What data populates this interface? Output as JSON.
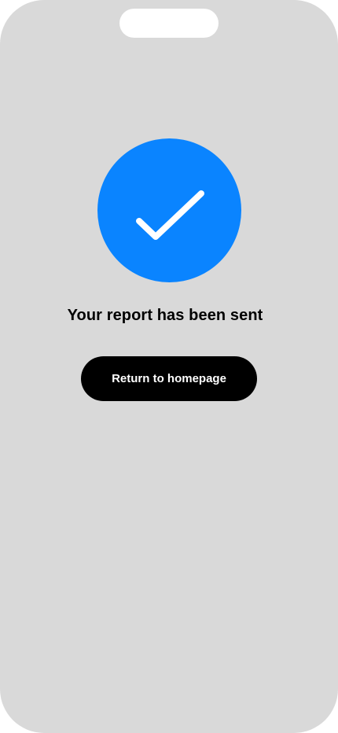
{
  "confirmation": {
    "icon": "checkmark-icon",
    "icon_bg_color": "#0a84ff",
    "icon_fg_color": "#ffffff",
    "title": "Your report has been sent"
  },
  "actions": {
    "return_label": "Return to homepage",
    "button_bg_color": "#000000"
  },
  "colors": {
    "screen_bg": "#d9d9d9",
    "notch": "#ffffff"
  }
}
